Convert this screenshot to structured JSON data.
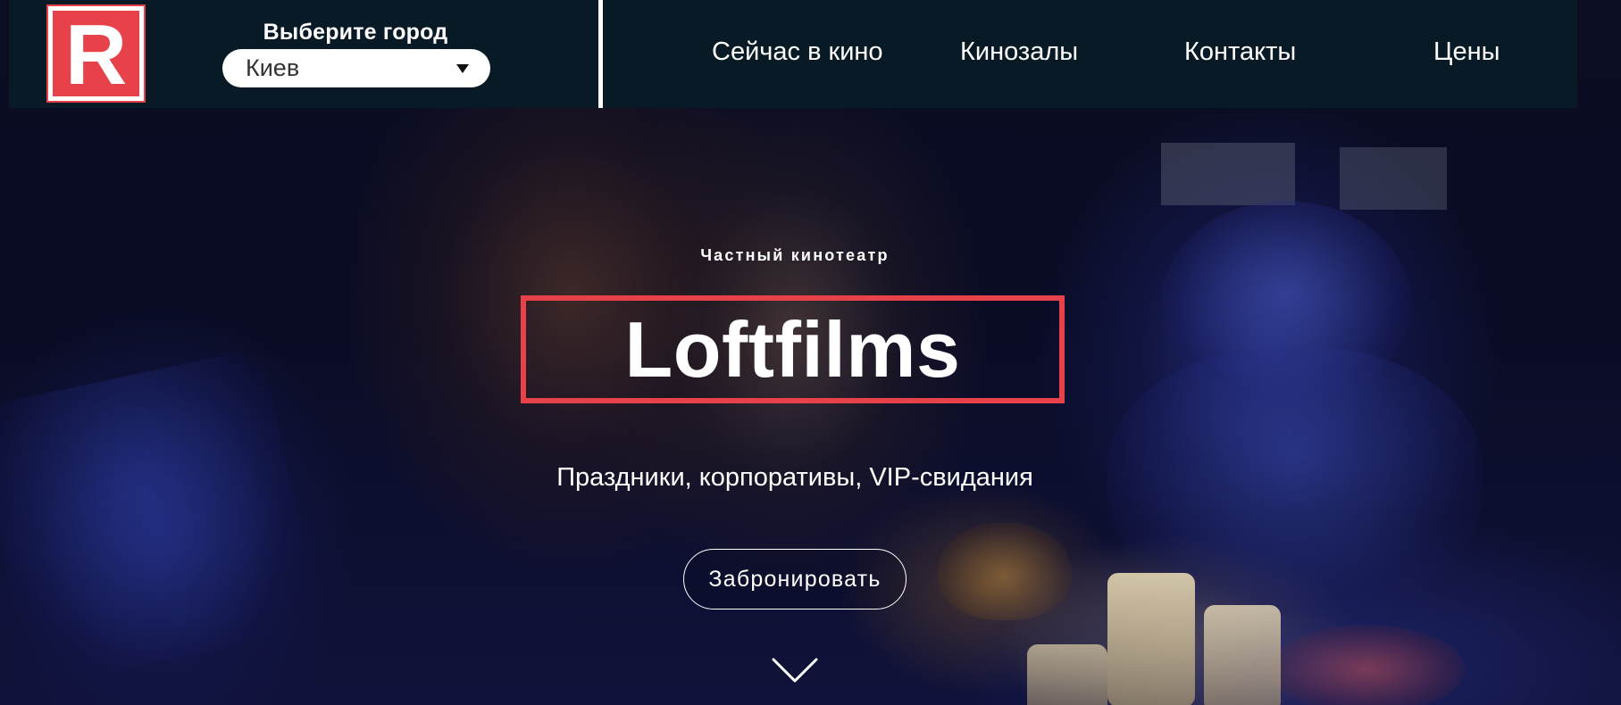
{
  "header": {
    "logo_letter": "R",
    "city_label": "Выберите город",
    "city_select": {
      "value": "Киев"
    },
    "nav": [
      {
        "label": "Сейчас в кино"
      },
      {
        "label": "Кинозалы"
      },
      {
        "label": "Контакты"
      },
      {
        "label": "Цены"
      }
    ]
  },
  "hero": {
    "eyebrow": "Частный кинотеатр",
    "title": "Loftfilms",
    "subtitle": "Праздники, корпоративы, VIP-свидания",
    "cta_label": "Забронировать",
    "scroll_icon": "chevron-down-icon"
  },
  "colors": {
    "accent_red": "#e74249",
    "header_bg": "#081a26",
    "text": "#ffffff"
  }
}
